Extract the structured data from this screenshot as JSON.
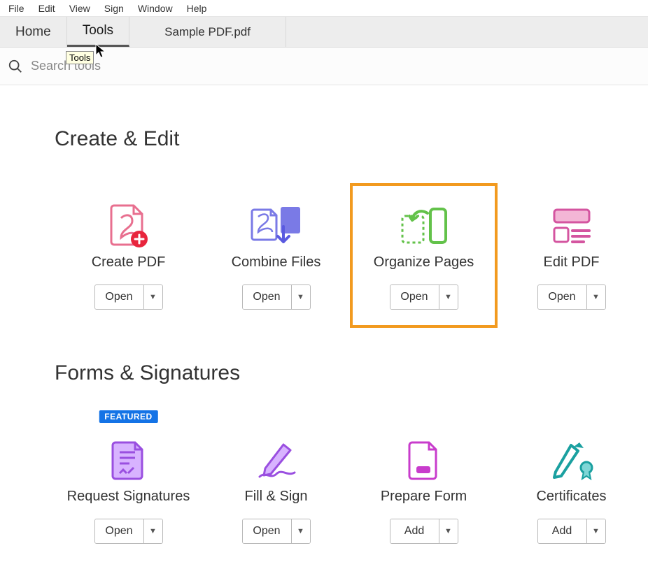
{
  "menubar": [
    "File",
    "Edit",
    "View",
    "Sign",
    "Window",
    "Help"
  ],
  "tabs": {
    "home": "Home",
    "tools": "Tools",
    "file": "Sample PDF.pdf"
  },
  "tooltip": "Tools",
  "search": {
    "placeholder": "Search tools"
  },
  "sections": {
    "create_edit": {
      "title": "Create & Edit",
      "tools": [
        {
          "label": "Create PDF",
          "button": "Open"
        },
        {
          "label": "Combine Files",
          "button": "Open"
        },
        {
          "label": "Organize Pages",
          "button": "Open",
          "highlighted": true
        },
        {
          "label": "Edit PDF",
          "button": "Open"
        }
      ]
    },
    "forms_sign": {
      "title": "Forms & Signatures",
      "tools": [
        {
          "label": "Request Signatures",
          "button": "Open",
          "badge": "FEATURED"
        },
        {
          "label": "Fill & Sign",
          "button": "Open"
        },
        {
          "label": "Prepare Form",
          "button": "Add"
        },
        {
          "label": "Certificates",
          "button": "Add"
        }
      ]
    }
  },
  "colors": {
    "highlight": "#f29a1f",
    "featured": "#1473e6"
  }
}
